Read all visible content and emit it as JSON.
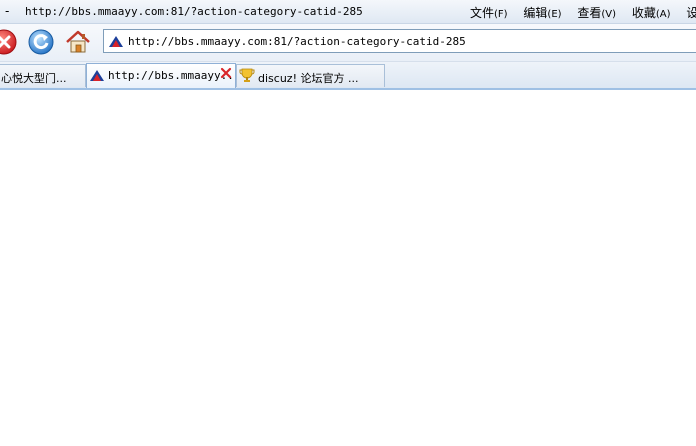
{
  "window": {
    "dash": "-",
    "title": "http://bbs.mmaayy.com:81/?action-category-catid-285"
  },
  "menu": [
    {
      "label": "文件",
      "key": "(F)"
    },
    {
      "label": "编辑",
      "key": "(E)"
    },
    {
      "label": "查看",
      "key": "(V)"
    },
    {
      "label": "收藏",
      "key": "(A)"
    },
    {
      "label": "设",
      "key": ""
    }
  ],
  "address": {
    "url": "http://bbs.mmaayy.com:81/?action-category-catid-285"
  },
  "tabs": [
    {
      "label": "心悦大型门..."
    },
    {
      "label": "http://bbs.mmaayy.."
    },
    {
      "label": "discuz! 论坛官方 ..."
    }
  ],
  "icons": {
    "stop": "stop-icon",
    "refresh": "refresh-icon",
    "home": "home-icon",
    "site": "site-favicon",
    "close": "close-icon",
    "discuz": "trophy-icon"
  },
  "colors": {
    "close_red": "#d9262a",
    "refresh_blue": "#2a7fd4"
  }
}
